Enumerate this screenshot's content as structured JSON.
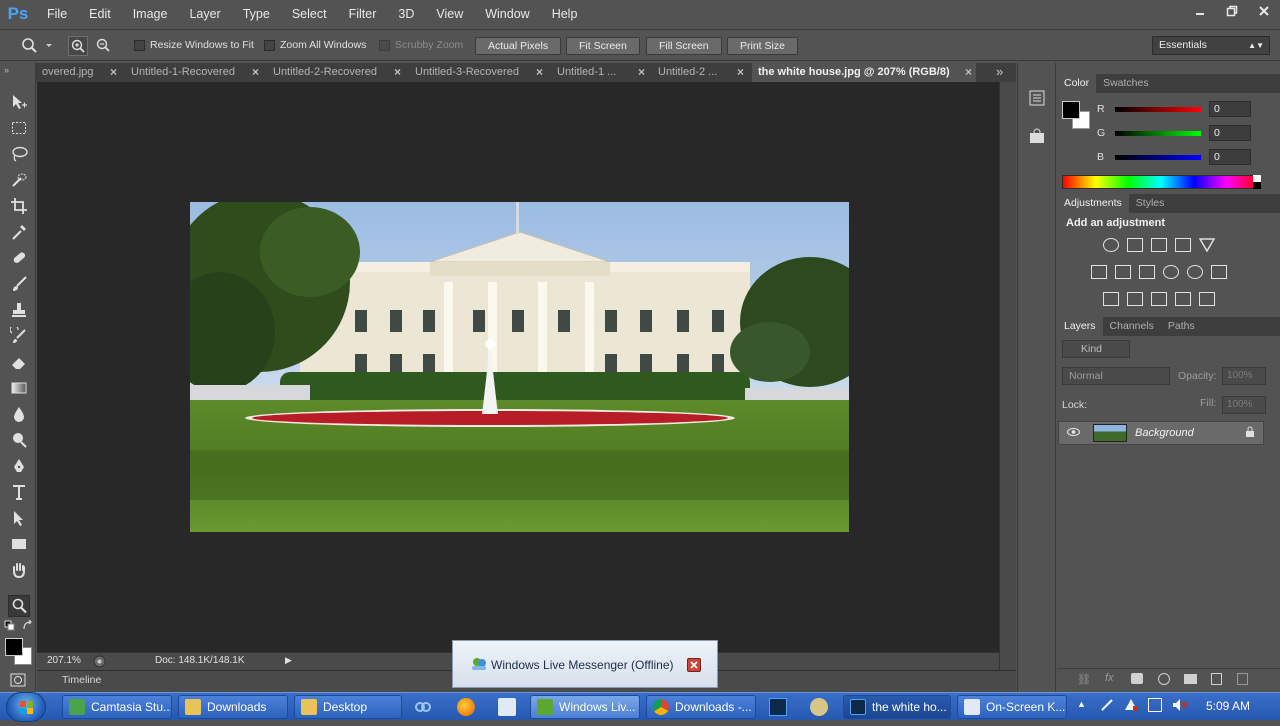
{
  "app": {
    "logo": "Ps",
    "workspace": "Essentials"
  },
  "menu": [
    "File",
    "Edit",
    "Image",
    "Layer",
    "Type",
    "Select",
    "Filter",
    "3D",
    "View",
    "Window",
    "Help"
  ],
  "options": {
    "resize_windows": "Resize Windows to Fit",
    "zoom_all": "Zoom All Windows",
    "scrubby_zoom": "Scrubby Zoom",
    "actual_pixels": "Actual Pixels",
    "fit_screen": "Fit Screen",
    "fill_screen": "Fill Screen",
    "print_size": "Print Size"
  },
  "tabs": [
    {
      "label": "overed.jpg",
      "active": false
    },
    {
      "label": "Untitled-1-Recovered",
      "active": false
    },
    {
      "label": "Untitled-2-Recovered",
      "active": false
    },
    {
      "label": "Untitled-3-Recovered",
      "active": false
    },
    {
      "label": "Untitled-1 ...",
      "active": false
    },
    {
      "label": "Untitled-2 ...",
      "active": false
    },
    {
      "label": "the white house.jpg @ 207% (RGB/8)",
      "active": true
    }
  ],
  "status": {
    "zoom": "207.1%",
    "doc": "Doc: 148.1K/148.1K"
  },
  "timeline_label": "Timeline",
  "color_panel": {
    "tabs": [
      "Color",
      "Swatches"
    ],
    "channels": [
      {
        "label": "R",
        "value": "0"
      },
      {
        "label": "G",
        "value": "0"
      },
      {
        "label": "B",
        "value": "0"
      }
    ]
  },
  "adjustments_panel": {
    "tabs": [
      "Adjustments",
      "Styles"
    ],
    "heading": "Add an adjustment"
  },
  "layers_panel": {
    "tabs": [
      "Layers",
      "Channels",
      "Paths"
    ],
    "kind": "Kind",
    "blend_mode": "Normal",
    "opacity_label": "Opacity:",
    "opacity_value": "100%",
    "lock_label": "Lock:",
    "fill_label": "Fill:",
    "fill_value": "100%",
    "layers": [
      {
        "name": "Background"
      }
    ]
  },
  "popup": {
    "text": "Windows Live Messenger (Offline)"
  },
  "taskbar": {
    "items": [
      {
        "label": "Camtasia Stu..."
      },
      {
        "label": "Downloads"
      },
      {
        "label": "Desktop"
      },
      {
        "label": "Windows Liv..."
      },
      {
        "label": "Downloads -..."
      },
      {
        "label": "the white ho..."
      },
      {
        "label": "On-Screen K..."
      }
    ],
    "clock": "5:09 AM"
  },
  "colors": {
    "accent": "#49a3ff",
    "canvas": "#282828",
    "panel": "#535353",
    "taskbar": "#2d62bd"
  }
}
